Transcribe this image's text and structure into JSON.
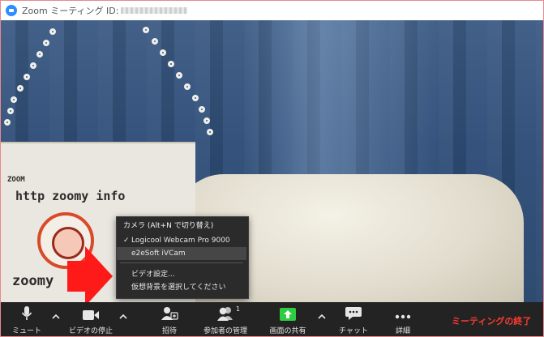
{
  "window": {
    "title": "Zoom ミーティング ID:"
  },
  "camera_menu": {
    "header": "カメラ (Alt+N で切り替え)",
    "options": [
      {
        "label": "Logicool Webcam Pro 9000",
        "checked": true
      },
      {
        "label": "e2eSoft iVCam",
        "checked": false,
        "highlighted": true
      }
    ],
    "settings": [
      {
        "label": "ビデオ設定..."
      },
      {
        "label": "仮想背景を選択してください"
      }
    ],
    "check_mark": "✓"
  },
  "video": {
    "sign_lines": [
      "ZOOM",
      "http  zoomy info",
      "zoomy"
    ]
  },
  "toolbar": {
    "mute_label": "ミュート",
    "video_label": "ビデオの停止",
    "invite_label": "招待",
    "participants_label": "参加者の管理",
    "participants_count": "1",
    "share_label": "画面の共有",
    "chat_label": "チャット",
    "more_label": "詳細",
    "end_label": "ミーティングの終了"
  },
  "colors": {
    "end_meeting": "#ff3b30",
    "share_icon": "#2ecc40",
    "arrow": "#ff1a1a",
    "zoom_blue": "#2d8cff"
  }
}
